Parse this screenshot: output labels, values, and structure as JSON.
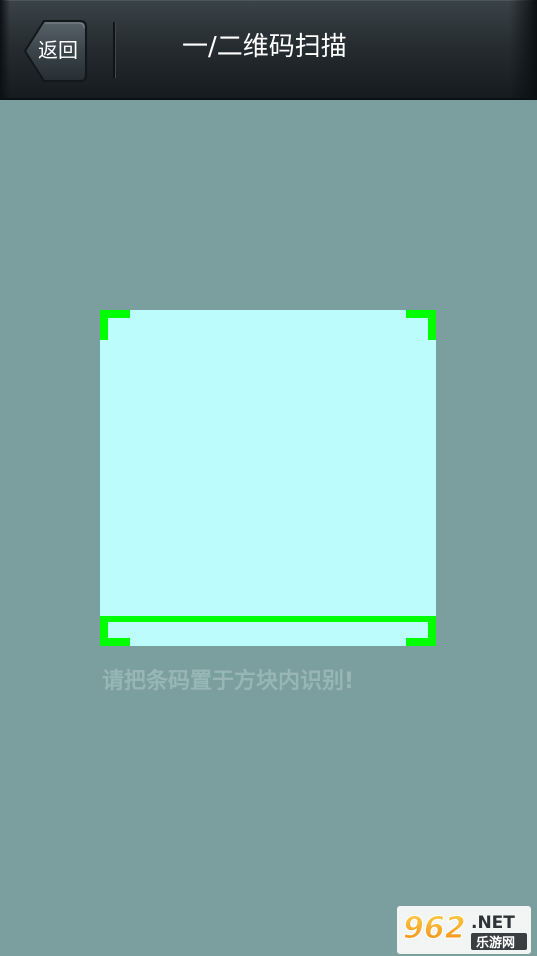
{
  "header": {
    "back_label": "返回",
    "title": "一/二维码扫描"
  },
  "scanner": {
    "hint": "请把条码置于方块内识别!"
  },
  "watermark": {
    "number": "962",
    "tld": ".NET",
    "subtitle": "乐游网"
  },
  "colors": {
    "background": "#7a9f9e",
    "scan_area": "#bdfcfd",
    "scan_accent": "#00ff00",
    "hint_text": "#98b6b6"
  }
}
